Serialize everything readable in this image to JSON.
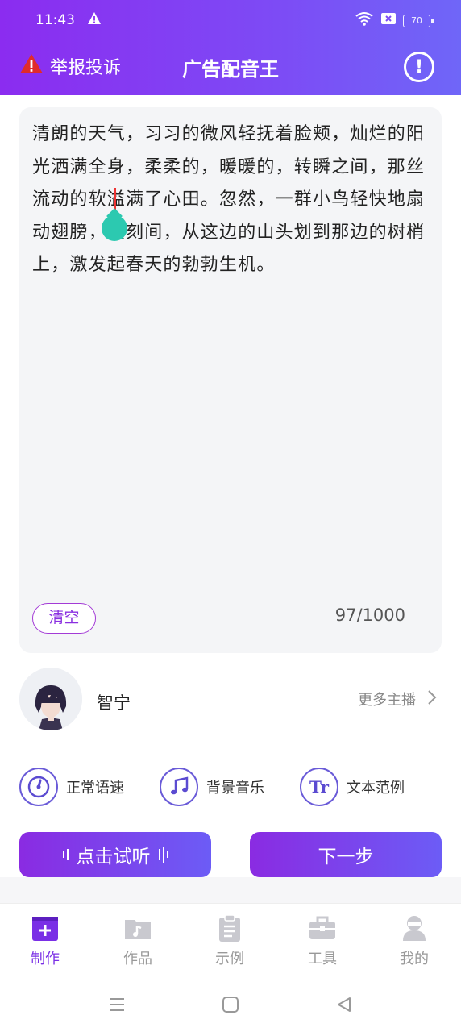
{
  "status": {
    "time": "11:43",
    "battery": "70"
  },
  "header": {
    "report_label": "举报投诉",
    "title": "广告配音王"
  },
  "editor": {
    "text": "清朗的天气，习习的微风轻抚着脸颊，灿烂的阳光洒满全身，柔柔的，暖暖的，转瞬之间，那丝流动的软溢满了心田。忽然，一群小鸟轻快地扇动翅膀，顷刻间，从这边的山头划到那边的树梢上，激发起春天的勃勃生机。",
    "clear_label": "清空",
    "counter": "97/1000"
  },
  "voice": {
    "name": "智宁",
    "more_label": "更多主播"
  },
  "options": [
    {
      "label": "正常语速",
      "icon": "speed-gauge-icon"
    },
    {
      "label": "背景音乐",
      "icon": "music-note-icon"
    },
    {
      "label": "文本范例",
      "icon": "text-sample-icon",
      "glyph": "Tr"
    }
  ],
  "actions": {
    "listen_label": "点击试听",
    "next_label": "下一步"
  },
  "tabs": [
    {
      "label": "制作",
      "active": true
    },
    {
      "label": "作品",
      "active": false
    },
    {
      "label": "示例",
      "active": false
    },
    {
      "label": "工具",
      "active": false
    },
    {
      "label": "我的",
      "active": false
    }
  ],
  "colors": {
    "accent": "#7a2fe6",
    "cursor_handle": "#2cc9b0",
    "warn": "#e02b2b"
  }
}
